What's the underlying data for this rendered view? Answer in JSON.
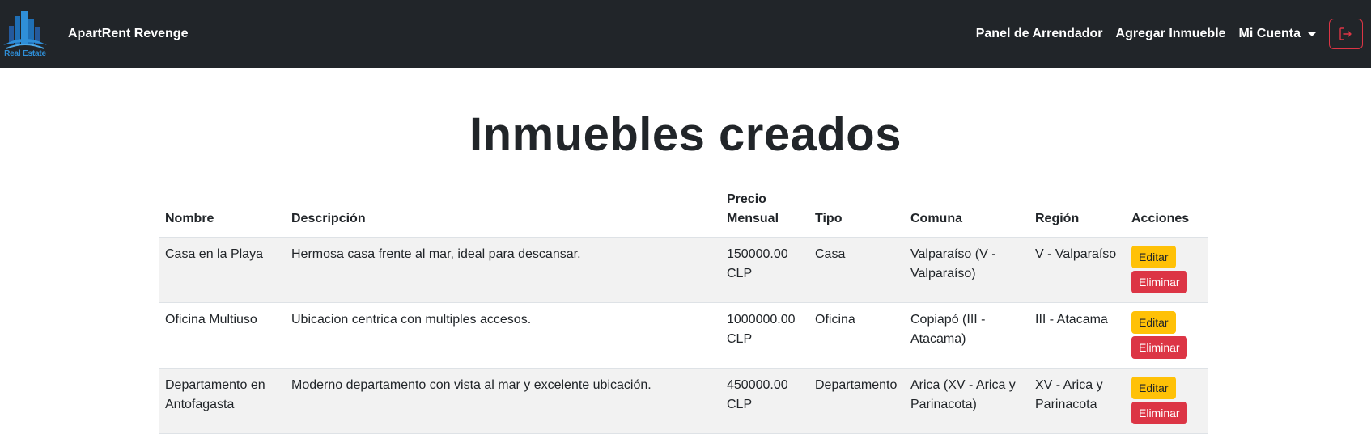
{
  "navbar": {
    "logo_text": "Real Estate",
    "brand": "ApartRent Revenge",
    "links": [
      "Panel de Arrendador",
      "Agregar Inmueble"
    ],
    "account_label": "Mi Cuenta",
    "colors": {
      "bg": "#212529",
      "logout_border": "#dc3545",
      "logo_blue": "#2f8fd8"
    }
  },
  "main": {
    "title": "Inmuebles creados",
    "columns": [
      "Nombre",
      "Descripción",
      "Precio Mensual",
      "Tipo",
      "Comuna",
      "Región",
      "Acciones"
    ],
    "rows": [
      {
        "nombre": "Casa en la Playa",
        "descripcion": "Hermosa casa frente al mar, ideal para descansar.",
        "precio": "150000.00 CLP",
        "tipo": "Casa",
        "comuna": "Valparaíso (V - Valparaíso)",
        "region": "V - Valparaíso",
        "edit": "Editar",
        "delete": "Eliminar"
      },
      {
        "nombre": "Oficina Multiuso",
        "descripcion": "Ubicacion centrica con multiples accesos.",
        "precio": "1000000.00 CLP",
        "tipo": "Oficina",
        "comuna": "Copiapó (III - Atacama)",
        "region": "III - Atacama",
        "edit": "Editar",
        "delete": "Eliminar"
      },
      {
        "nombre": "Departamento en Antofagasta",
        "descripcion": "Moderno departamento con vista al mar y excelente ubicación.",
        "precio": "450000.00 CLP",
        "tipo": "Departamento",
        "comuna": "Arica (XV - Arica y Parinacota)",
        "region": "XV - Arica y Parinacota",
        "edit": "Editar",
        "delete": "Eliminar"
      }
    ],
    "colors": {
      "edit_button": "#ffc107",
      "delete_button": "#dc3545",
      "stripe": "#f2f2f2"
    }
  }
}
